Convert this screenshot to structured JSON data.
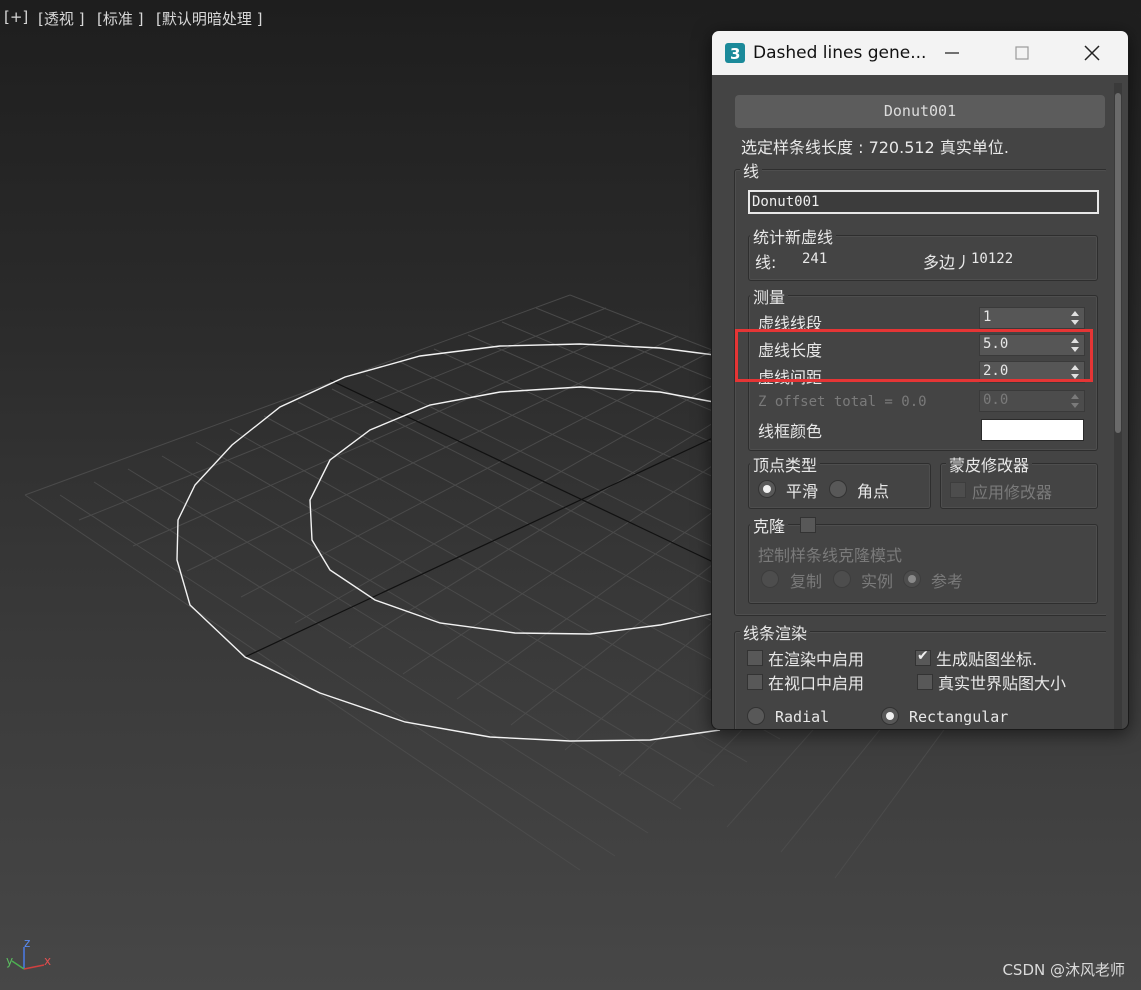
{
  "viewport": {
    "labels": [
      "[+]",
      "[透视 ]",
      "[标准 ]",
      "[默认明暗处理 ]"
    ],
    "gizmo": {
      "x": "x",
      "y": "y",
      "z": "z"
    }
  },
  "watermark": "CSDN @沐风老师",
  "dialog": {
    "title": "Dashed lines gene...",
    "object_button": "Donut001",
    "spline_length_text": "选定样条线长度 : 720.512 真实单位.",
    "line_group": {
      "label": "线",
      "name_value": "Donut001"
    },
    "stats_group": {
      "label": "统计新虚线",
      "lines_label": "线:",
      "lines_value": "241",
      "poly_label": "多边丿",
      "poly_value": "10122"
    },
    "measure_group": {
      "label": "测量",
      "segments_label": "虚线线段",
      "segments_value": "1",
      "length_label": "虚线长度",
      "length_value": "5.0",
      "spacing_label": "虚线间距",
      "spacing_value": "2.0",
      "zoffset_label": "Z offset total = 0.0",
      "zoffset_value": "0.0",
      "wire_color_label": "线框颜色",
      "wire_color": "#ffffff"
    },
    "vertex_group": {
      "label": "顶点类型",
      "smooth_label": "平滑",
      "smooth_selected": true,
      "corner_label": "角点",
      "corner_selected": false
    },
    "skin_group": {
      "label": "蒙皮修改器",
      "apply_label": "应用修改器",
      "apply_checked": false
    },
    "clone_group": {
      "label": "克隆",
      "checked": false,
      "mode_label": "控制样条线克隆模式",
      "copy_label": "复制",
      "instance_label": "实例",
      "reference_label": "参考",
      "selected": "参考"
    },
    "render_group": {
      "label": "线条渲染",
      "enable_render_label": "在渲染中启用",
      "enable_render_checked": false,
      "gen_mapping_label": "生成贴图坐标.",
      "gen_mapping_checked": true,
      "enable_viewport_label": "在视口中启用",
      "enable_viewport_checked": false,
      "real_world_label": "真实世界贴图大小",
      "real_world_checked": false,
      "radial_label": "Radial",
      "radial_selected": false,
      "rectangular_label": "Rectangular",
      "rectangular_selected": true
    }
  },
  "colors": {
    "highlight": "#e53535",
    "panel": "#444444",
    "titlebar": "#f3f3f3"
  }
}
